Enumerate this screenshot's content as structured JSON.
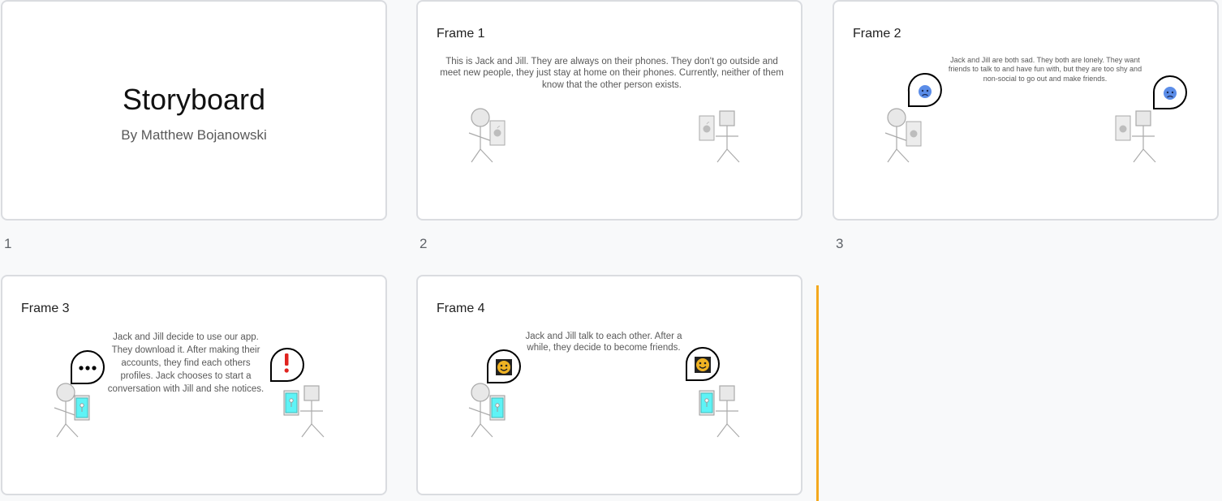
{
  "slides": [
    {
      "number": "1",
      "title": "Storyboard",
      "subtitle": "By Matthew Bojanowski"
    },
    {
      "number": "2",
      "title": "Frame 1",
      "caption": "This is Jack and Jill. They are always on their phones. They don't go outside and meet new people, they just stay at home on their phones. Currently, neither of them know that the other person exists."
    },
    {
      "number": "3",
      "title": "Frame 2",
      "caption": "Jack and Jill are both sad. They both are lonely. They want friends to talk to and have fun with, but they are too shy and non-social to go out and make friends."
    },
    {
      "number": "",
      "title": "Frame 3",
      "caption": "Jack and Jill decide to use our app. They download it. After making their accounts, they find each others profiles. Jack chooses to start a conversation with Jill and she notices."
    },
    {
      "number": "",
      "title": "Frame 4",
      "caption": "Jack and Jill talk to each other. After a while, they decide to become friends."
    }
  ],
  "colors": {
    "background": "#f8f9fa",
    "slide_border": "#dadce0",
    "drop_indicator": "#f4a81d",
    "sad_face": "#5b8de8",
    "happy_face": "#f0b323",
    "app_screen": "#5ef3f6",
    "alert": "#e0231f"
  },
  "icons": [
    "apple-logo-icon",
    "sad-face-icon",
    "happy-face-icon",
    "ellipsis-icon",
    "exclamation-icon",
    "app-icon"
  ]
}
